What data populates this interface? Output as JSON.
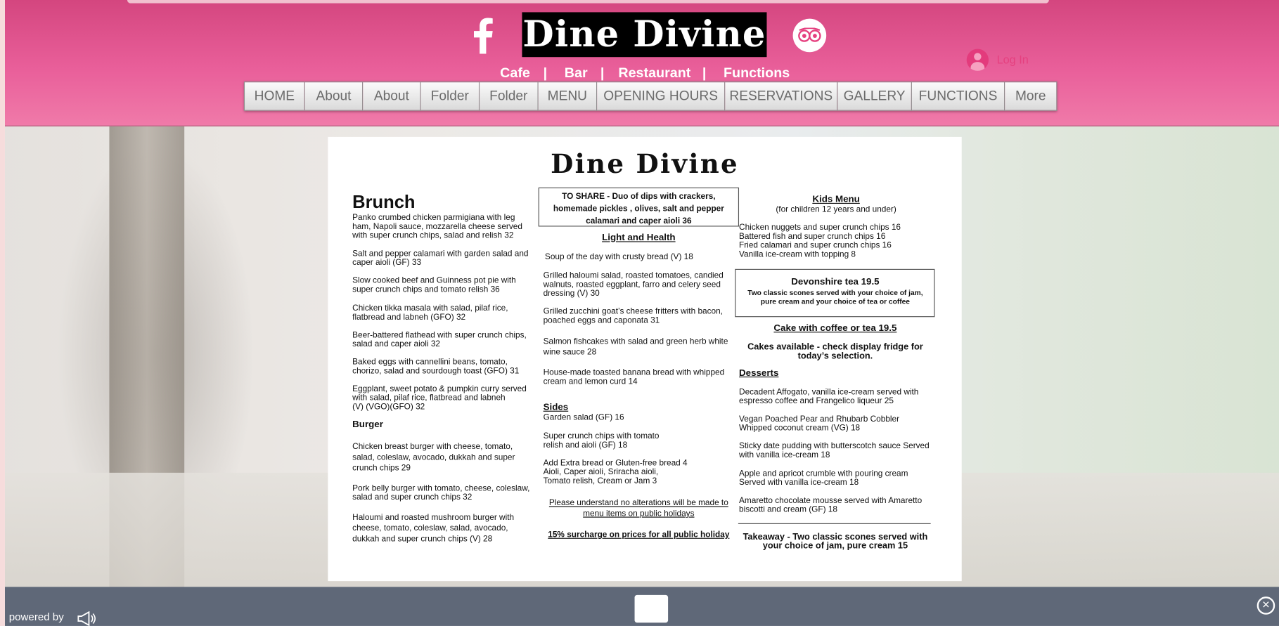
{
  "header": {
    "logo_text": "Dine Divine",
    "social": {
      "facebook_icon": "facebook-f-icon",
      "tripadvisor_icon": "tripadvisor-owl-icon"
    },
    "tagline": [
      "Cafe",
      "|",
      "Bar",
      "|",
      "Restaurant",
      "|",
      "Functions"
    ],
    "login_label": "Log In",
    "colors": {
      "header_pink": "#e6528f",
      "footer_gray": "#5f6878"
    }
  },
  "nav": [
    "HOME",
    "About",
    "About",
    "Folder",
    "Folder",
    "MENU",
    "OPENING HOURS",
    "RESERVATIONS",
    "GALLERY",
    "FUNCTIONS",
    "More"
  ],
  "menu": {
    "title": "Dine Divine",
    "brunch": {
      "heading": "Brunch",
      "items": [
        [
          "Panko crumbed chicken parmigiana with leg",
          "ham, Napoli sauce, mozzarella cheese served",
          "with super crunch chips, salad and relish 32"
        ],
        [
          "Salt and pepper calamari with garden salad and",
          "caper aioli (GF) 33"
        ],
        [
          "Slow cooked beef and Guinness pot pie with",
          "super crunch chips and tomato relish 36"
        ],
        [
          "Chicken tikka masala with salad, pilaf rice,",
          "flatbread and labneh (GFO) 32"
        ],
        [
          "Beer-battered flathead with super crunch chips,",
          "salad and caper aioli 32"
        ],
        [
          "Baked eggs with cannellini beans, tomato,",
          "chorizo, salad and sourdough toast (GFO) 31"
        ],
        [
          "Eggplant, sweet potato & pumpkin curry served",
          "with salad, pilaf rice, flatbread and labneh",
          "(V) (VGO)(GFO) 32"
        ]
      ]
    },
    "burger": {
      "heading": "Burger",
      "items": [
        [
          "Chicken breast burger with cheese, tomato,",
          "salad, coleslaw, avocado, dukkah and super",
          "crunch chips 29"
        ],
        [
          "Pork belly burger with tomato, cheese, coleslaw,",
          "salad and super crunch chips 32"
        ],
        [
          "Haloumi and roasted mushroom burger with",
          "cheese, tomato, coleslaw, salad, avocado,",
          "dukkah and super crunch chips (V) 28"
        ]
      ]
    },
    "share": [
      "TO SHARE - Duo of dips with crackers,",
      "homemade pickles , olives, salt and pepper",
      "calamari and caper aioli 36"
    ],
    "light": {
      "heading": "Light and Health",
      "items": [
        [
          "Soup of the day with crusty bread (V) 18"
        ],
        [
          "Grilled haloumi salad, roasted tomatoes, candied",
          "walnuts, roasted eggplant, farro and celery seed",
          "dressing (V) 30"
        ],
        [
          "Grilled zucchini goat’s cheese fritters with bacon,",
          "poached eggs and caponata  31"
        ],
        [
          "Salmon fishcakes with salad and green herb white",
          "wine sauce 28"
        ],
        [
          "House-made toasted banana bread with whipped",
          "cream and lemon curd 14"
        ]
      ]
    },
    "sides": {
      "heading": "Sides",
      "items": [
        [
          "Garden salad (GF) 16"
        ],
        [
          "Super crunch chips with tomato",
          " relish and aioli (GF) 18"
        ],
        [
          "Add Extra bread or Gluten-free bread 4",
          "Aioli, Caper aioli, Sriracha aioli,",
          "Tomato relish, Cream or Jam 3"
        ]
      ]
    },
    "notice": [
      "Please understand no alterations will be made to",
      "menu items on public holidays"
    ],
    "surcharge": "15% surcharge on prices for all public holiday",
    "kids": {
      "heading": "Kids Menu",
      "sub": "(for children 12 years and under)",
      "items": [
        "Chicken nuggets and super crunch chips 16",
        "Battered fish and super crunch chips 16",
        "Fried calamari and super crunch chips 16",
        "Vanilla ice-cream with topping 8"
      ]
    },
    "devonshire": {
      "heading": "Devonshire tea 19.5",
      "text": [
        "Two classic scones served with your choice of jam,",
        "pure cream and your choice of tea or coffee"
      ]
    },
    "cake": {
      "heading": "Cake with coffee or tea 19.5",
      "text": [
        "Cakes available - check display fridge for",
        "today’s selection."
      ]
    },
    "desserts": {
      "heading": "Desserts",
      "items": [
        [
          "Decadent Affogato, vanilla ice-cream served with",
          "espresso coffee and Frangelico liqueur 25"
        ],
        [
          "Vegan Poached Pear and Rhubarb Cobbler",
          "Whipped coconut cream (VG) 18"
        ],
        [
          "Sticky date pudding with butterscotch sauce Served",
          "with vanilla ice-cream 18"
        ],
        [
          "Apple and apricot crumble with pouring cream",
          "Served with vanilla ice-cream 18"
        ],
        [
          "Amaretto chocolate mousse served with Amaretto",
          "biscotti and cream (GF) 18"
        ]
      ]
    },
    "takeaway": [
      "Takeaway - Two classic scones served with",
      "your choice of jam, pure cream 15"
    ]
  },
  "footer": {
    "powered_by": "powered by",
    "megaphone_icon": "megaphone-icon",
    "close_icon": "close-circle-icon"
  }
}
